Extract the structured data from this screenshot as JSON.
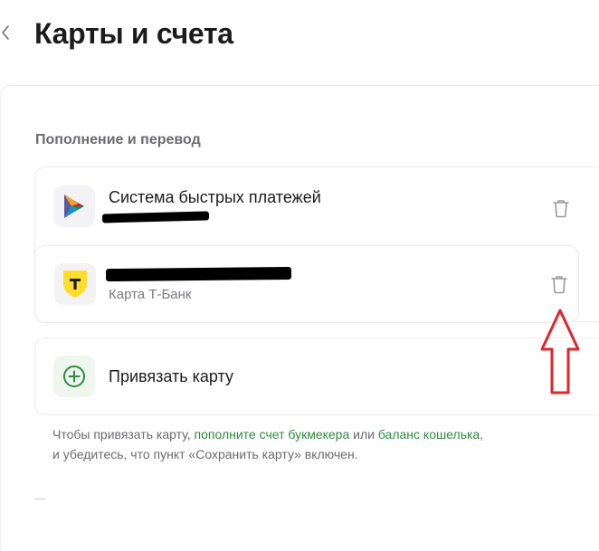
{
  "header": {
    "title": "Карты и счета"
  },
  "section": {
    "title": "Пополнение и перевод"
  },
  "methods": [
    {
      "name": "Система быстрых платежей",
      "subtitle": "",
      "logo": "sbp-logo",
      "action_icon": "trash-icon"
    },
    {
      "name": "",
      "subtitle": "Карта Т-Банк",
      "logo": "tbank-logo",
      "action_icon": "trash-icon"
    }
  ],
  "add_card": {
    "label": "Привязать карту",
    "icon": "plus-circle-icon"
  },
  "hint": {
    "text_1": "Чтобы привязать карту, ",
    "link_1": "пополните счет букмекера",
    "text_2": " или ",
    "link_2": "баланс кошелька",
    "text_3": ",",
    "text_4": "и убедитесь, что пункт «Сохранить карту» включен."
  },
  "colors": {
    "accent_green": "#2e8b3e",
    "tbank_yellow": "#ffdd2d",
    "annotation_red": "#e0252b"
  }
}
